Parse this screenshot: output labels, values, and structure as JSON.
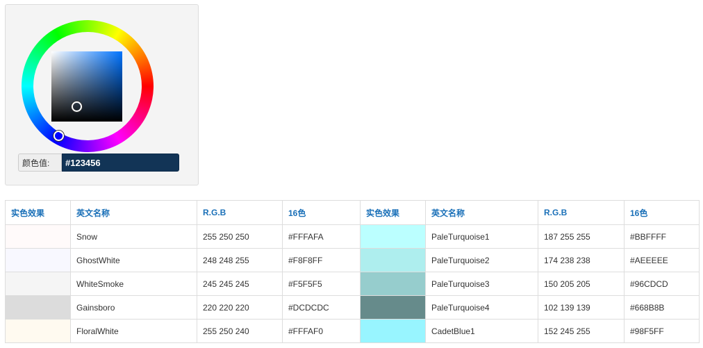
{
  "picker": {
    "label": "颜色值:",
    "value": "#123456",
    "base_hue_color": "#0073ff"
  },
  "table": {
    "headers": [
      "实色效果",
      "英文名称",
      "R.G.B",
      "16色",
      "实色效果",
      "英文名称",
      "R.G.B",
      "16色"
    ],
    "rows": [
      {
        "left": {
          "color": "#FFFAFA",
          "name": "Snow",
          "rgb": "255 250 250",
          "hex": "#FFFAFA"
        },
        "right": {
          "color": "#BBFFFF",
          "name": "PaleTurquoise1",
          "rgb": "187 255 255",
          "hex": "#BBFFFF"
        }
      },
      {
        "left": {
          "color": "#F8F8FF",
          "name": "GhostWhite",
          "rgb": "248 248 255",
          "hex": "#F8F8FF"
        },
        "right": {
          "color": "#AEEEEE",
          "name": "PaleTurquoise2",
          "rgb": "174 238 238",
          "hex": "#AEEEEE"
        }
      },
      {
        "left": {
          "color": "#F5F5F5",
          "name": "WhiteSmoke",
          "rgb": "245 245 245",
          "hex": "#F5F5F5"
        },
        "right": {
          "color": "#96CDCD",
          "name": "PaleTurquoise3",
          "rgb": "150 205 205",
          "hex": "#96CDCD"
        }
      },
      {
        "left": {
          "color": "#DCDCDC",
          "name": "Gainsboro",
          "rgb": "220 220 220",
          "hex": "#DCDCDC"
        },
        "right": {
          "color": "#668B8B",
          "name": "PaleTurquoise4",
          "rgb": "102 139 139",
          "hex": "#668B8B"
        }
      },
      {
        "left": {
          "color": "#FFFAF0",
          "name": "FloralWhite",
          "rgb": "255 250 240",
          "hex": "#FFFAF0"
        },
        "right": {
          "color": "#98F5FF",
          "name": "CadetBlue1",
          "rgb": "152 245 255",
          "hex": "#98F5FF"
        }
      }
    ]
  }
}
